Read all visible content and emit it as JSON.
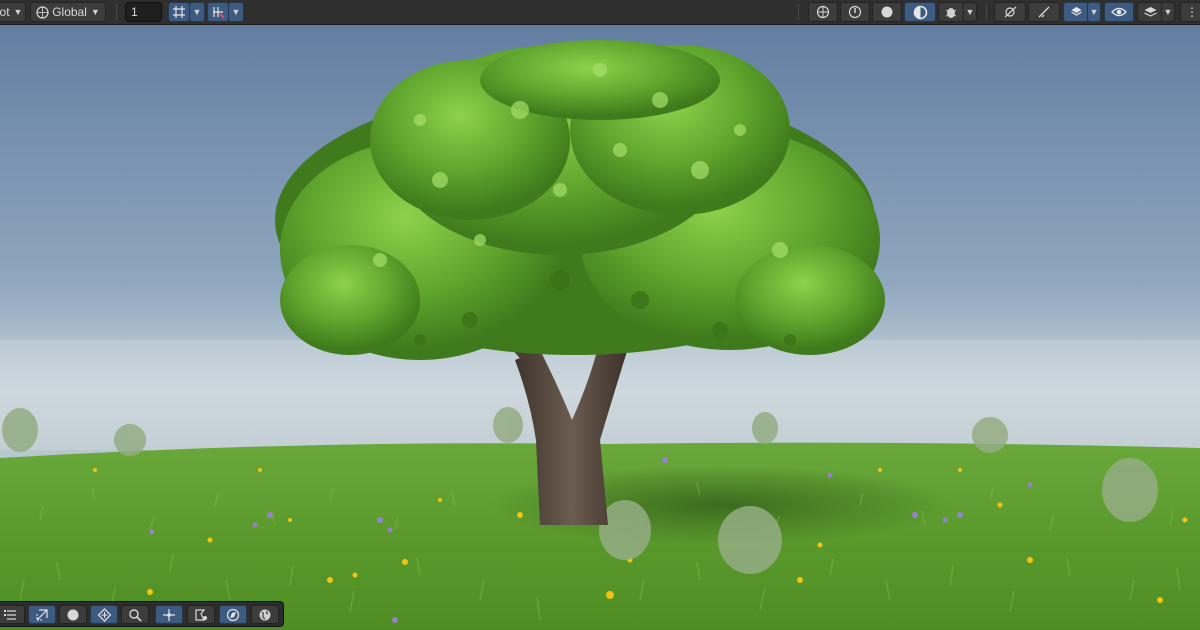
{
  "toolbar": {
    "pivot_label": "ot",
    "global_label": "Global",
    "grid_value": "1",
    "icons": [
      "dropdown-caret",
      "globe-icon",
      "grid-snap-icon",
      "increment-snap-icon",
      "2d-toggle-icon",
      "lighting-icon",
      "audio-icon",
      "effects-icon",
      "scene-visibility-icon",
      "gizmos-icon",
      "draw-mode-icon",
      "camera-icon",
      "eye-icon",
      "layers-icon"
    ]
  },
  "overlay_tools": {
    "icons": [
      "hand-tool-icon",
      "move-tool-icon",
      "rotate-tool-icon",
      "scale-tool-icon",
      "search-icon",
      "transform-tool-icon",
      "rect-tool-icon",
      "compass-icon",
      "globe-icon"
    ]
  },
  "colors": {
    "toolbar_bg": "#2f2f2f",
    "button_active": "#3d5a80",
    "sky_top": "#6b86a8",
    "horizon": "#c5d2d8",
    "grass": "#5e9d2c",
    "foliage": "#5a9e2a",
    "trunk": "#5a4d43"
  }
}
